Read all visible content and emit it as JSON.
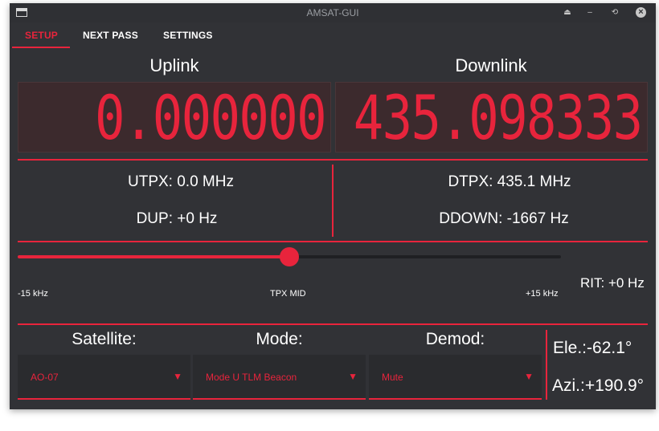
{
  "window": {
    "title": "AMSAT-GUI"
  },
  "tabs": [
    {
      "label": "SETUP",
      "active": true
    },
    {
      "label": "NEXT PASS",
      "active": false
    },
    {
      "label": "SETTINGS",
      "active": false
    }
  ],
  "uplink": {
    "label": "Uplink",
    "display": "0.000000"
  },
  "downlink": {
    "label": "Downlink",
    "display": "435.098333"
  },
  "info": {
    "utpx": "UTPX: 0.0 MHz",
    "dup": "DUP: +0 Hz",
    "dtpx": "DTPX: 435.1 MHz",
    "ddown": "DDOWN: -1667 Hz"
  },
  "slider": {
    "value_fraction": 0.5,
    "min_label": "-15 kHz",
    "mid_label": "TPX MID",
    "max_label": "+15 kHz"
  },
  "rit": "RIT: +0 Hz",
  "satellite": {
    "label": "Satellite:",
    "value": "AO-07"
  },
  "mode": {
    "label": "Mode:",
    "value": "Mode U TLM Beacon"
  },
  "demod": {
    "label": "Demod:",
    "value": "Mute"
  },
  "elevation": "Ele.:-62.1°",
  "azimuth": "Azi.:+190.9°",
  "colors": {
    "accent": "#e8243c",
    "background": "#313236"
  }
}
